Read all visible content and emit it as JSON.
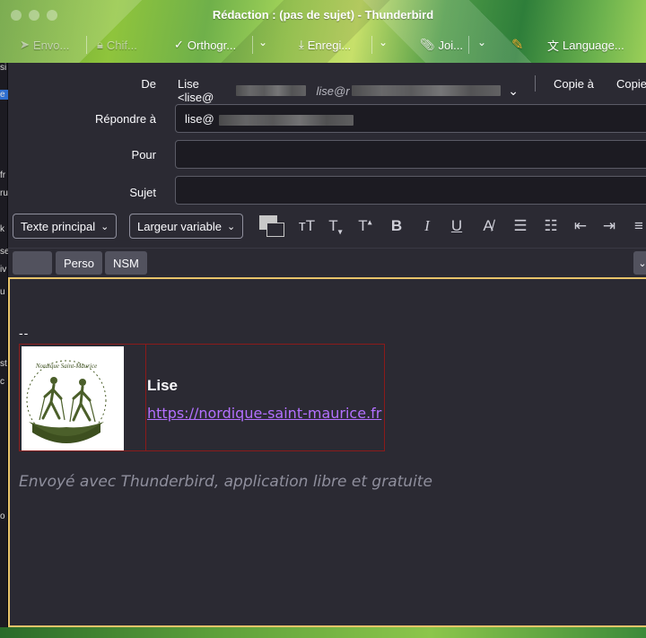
{
  "window": {
    "title": "Rédaction : (pas de sujet) - Thunderbird"
  },
  "toolbar": {
    "send_label": "Envo...",
    "encrypt_label": "Chif...",
    "spelling_label": "Orthogr...",
    "save_label": "Enregi...",
    "attach_label": "Joi...",
    "language_label": "Language..."
  },
  "header": {
    "from_label": "De",
    "from_value": "Lise <lise@",
    "from_secondary": "lise@r",
    "cc_label": "Copie à",
    "bcc_label": "Copie",
    "reply_to_label": "Répondre à",
    "reply_to_value": "lise@",
    "to_label": "Pour",
    "subject_label": "Sujet"
  },
  "format": {
    "paragraph_style": "Texte principal",
    "font_width": "Largeur variable"
  },
  "templates": {
    "items": [
      "Perso",
      "NSM"
    ]
  },
  "body": {
    "sig_separator": "--",
    "sig_name": "Lise",
    "sig_link": "https://nordique-saint-maurice.fr",
    "logo_text": "Nordique Saint-Maurice",
    "sent_with": "Envoyé avec Thunderbird, application libre et gratuite"
  },
  "left_strip": [
    "si",
    "e",
    "fr",
    "ru",
    "k",
    "se",
    "iv",
    "u",
    "st",
    "c",
    "o"
  ],
  "colors": {
    "accent_border": "#e8c46a",
    "link": "#b370ff",
    "sig_table_border": "#8b1a1a"
  }
}
